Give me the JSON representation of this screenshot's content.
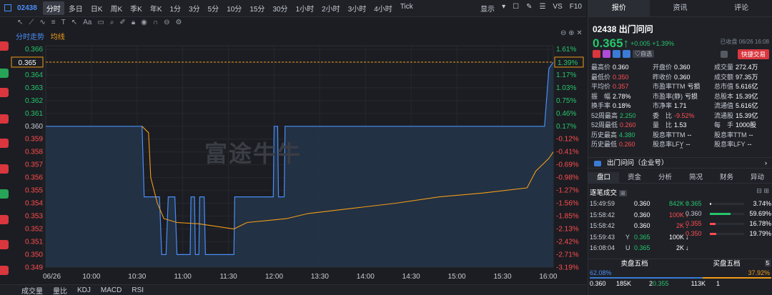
{
  "topbar": {
    "code": "02438",
    "timeframes": [
      "分时",
      "多日",
      "日K",
      "周K",
      "季K",
      "年K",
      "1分",
      "3分",
      "5分",
      "10分",
      "15分",
      "30分",
      "1小时",
      "2小时",
      "3小时",
      "4小时",
      "Tick"
    ],
    "active": "分时",
    "display": "显示",
    "vs": "VS",
    "f10": "F10"
  },
  "chart": {
    "tab1": "分时走势",
    "tab2": "均线",
    "watermark": "富途牛牛",
    "price_label": "0.365",
    "pct_label": "1.39%"
  },
  "chart_data": {
    "type": "line",
    "x_labels": [
      "06/26",
      "10:00",
      "10:30",
      "11:00",
      "11:30",
      "12:00",
      "13:30",
      "14:00",
      "14:30",
      "15:00",
      "15:30",
      "16:00"
    ],
    "y_left": [
      "0.366",
      "0.365",
      "0.364",
      "0.363",
      "0.362",
      "0.361",
      "0.360",
      "0.359",
      "0.358",
      "0.357",
      "0.356",
      "0.355",
      "0.354",
      "0.353",
      "0.352",
      "0.351",
      "0.350",
      "0.349"
    ],
    "y_right": [
      "1.61%",
      "1.39%",
      "1.17%",
      "1.03%",
      "0.75%",
      "0.46%",
      "0.17%",
      "-0.12%",
      "-0.41%",
      "-0.69%",
      "-0.98%",
      "-1.27%",
      "-1.56%",
      "-1.85%",
      "-2.13%",
      "-2.42%",
      "-2.71%",
      "-3.19%"
    ],
    "ylim": [
      0.349,
      0.366
    ],
    "series": [
      {
        "name": "分时走势",
        "color": "#4b8df8",
        "values": [
          [
            0,
            0.36
          ],
          [
            2.2,
            0.36
          ],
          [
            2.25,
            0.3545
          ],
          [
            2.6,
            0.3545
          ],
          [
            2.65,
            0.35
          ],
          [
            2.75,
            0.35
          ],
          [
            2.8,
            0.3545
          ],
          [
            2.95,
            0.3545
          ],
          [
            3.0,
            0.35
          ],
          [
            3.3,
            0.35
          ],
          [
            3.32,
            0.3545
          ],
          [
            3.4,
            0.3545
          ],
          [
            3.42,
            0.35
          ],
          [
            3.5,
            0.35
          ],
          [
            3.52,
            0.3545
          ],
          [
            3.62,
            0.3545
          ],
          [
            3.65,
            0.35
          ],
          [
            4.3,
            0.35
          ],
          [
            4.32,
            0.3545
          ],
          [
            5.2,
            0.3545
          ],
          [
            5.22,
            0.36
          ],
          [
            5.3,
            0.36
          ],
          [
            5.32,
            0.3545
          ],
          [
            5.45,
            0.3545
          ],
          [
            5.47,
            0.36
          ],
          [
            11.4,
            0.36
          ],
          [
            11.5,
            0.3645
          ],
          [
            11.6,
            0.365
          ]
        ]
      },
      {
        "name": "均线",
        "color": "#f29b19",
        "values": [
          [
            2.2,
            0.36
          ],
          [
            2.35,
            0.3595
          ],
          [
            2.4,
            0.356
          ],
          [
            2.55,
            0.354
          ],
          [
            2.7,
            0.3528
          ],
          [
            3.0,
            0.3525
          ],
          [
            3.5,
            0.3524
          ],
          [
            4.3,
            0.352
          ],
          [
            4.6,
            0.3525
          ],
          [
            5.5,
            0.3528
          ],
          [
            6,
            0.3532
          ],
          [
            7,
            0.3536
          ],
          [
            8,
            0.354
          ],
          [
            9,
            0.3545
          ],
          [
            10,
            0.3548
          ],
          [
            11,
            0.3552
          ],
          [
            11.2,
            0.3565
          ],
          [
            11.5,
            0.3575
          ],
          [
            11.6,
            0.358
          ]
        ]
      }
    ]
  },
  "bottomtabs": [
    "成交量",
    "量比",
    "KDJ",
    "MACD",
    "RSI"
  ],
  "panel": {
    "tabs": [
      "报价",
      "资讯",
      "评论"
    ],
    "name": "02438 出门问问",
    "price": "0.365",
    "change": "+0.005 +1.39%",
    "closed": "已收盘 06/26 16:08",
    "self": "自选",
    "quick": "快捷交易",
    "stats": [
      [
        "最高价",
        "0.360",
        "开盘价",
        "0.360",
        "成交量",
        "272.4万"
      ],
      [
        "最低价",
        "0.350",
        "昨收价",
        "0.360",
        "成交额",
        "97.35万"
      ],
      [
        "平均价",
        "0.357",
        "市盈率TTM",
        "亏损",
        "总市值",
        "5.616亿"
      ],
      [
        "振　幅",
        "2.78%",
        "市盈率(静)",
        "亏损",
        "总股本",
        "15.39亿"
      ],
      [
        "换手率",
        "0.18%",
        "市净率",
        "1.71",
        "流通值",
        "5.616亿"
      ],
      [
        "52周最高",
        "2.250",
        "委　比",
        "-9.52%",
        "流通股",
        "15.39亿"
      ],
      [
        "52周最低",
        "0.260",
        "量　比",
        "1.53",
        "每　手",
        "1000股"
      ],
      [
        "历史最高",
        "4.380",
        "股息率TTM",
        "--",
        "股息率TTM",
        "--"
      ],
      [
        "历史最低",
        "0.260",
        "股息率LFY",
        "--",
        "股息率LFY",
        "--"
      ]
    ],
    "corp": "出门问问（企业号）",
    "subtabs": [
      "盘口",
      "资金",
      "分析",
      "简况",
      "财务",
      "异动"
    ],
    "trade_title": "逐笔成交",
    "trades": [
      [
        "15:49:59",
        "0.360",
        "842K"
      ],
      [
        "15:58:42",
        "0.360",
        "100K"
      ],
      [
        "15:58:42",
        "0.360",
        "2K"
      ],
      [
        "15:59:43",
        "Y",
        "0.365",
        "100K"
      ],
      [
        "16:08:04",
        "U",
        "0.365",
        "2K"
      ]
    ],
    "dist": [
      [
        "0.365",
        "3.74%"
      ],
      [
        "0.360",
        "59.69%"
      ],
      [
        "0.355",
        "16.78%"
      ],
      [
        "0.350",
        "19.79%"
      ]
    ],
    "ob_sell": "卖盘五档",
    "ob_buy": "买盘五档",
    "ob_left_pct": "62.08%",
    "ob_right_pct": "37.92%",
    "ob_row": [
      "0.360",
      "185K",
      "2",
      "0.355",
      "113K",
      "1"
    ]
  }
}
